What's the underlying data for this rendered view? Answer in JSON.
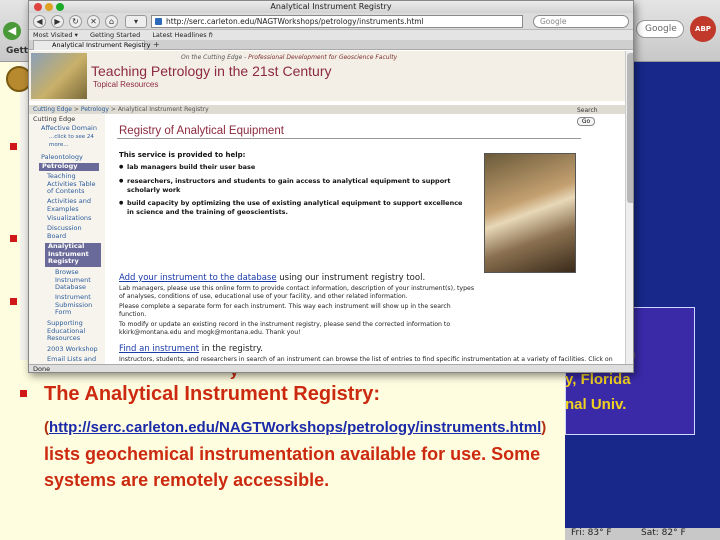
{
  "bg": {
    "getting": "Getting",
    "search_placeholder": "Google",
    "abp": "ABP",
    "weather": [
      "Fri: 83° F",
      "Sat: 82° F"
    ],
    "fragments": [
      "n",
      "y, Florida",
      "nal Univ."
    ]
  },
  "window": {
    "title": "Analytical Instrument Registry",
    "url": "http://serc.carleton.edu/NAGTWorkshops/petrology/instruments.html",
    "search_placeholder": "Google",
    "bookmarks": [
      "Most Visited ▾",
      "Getting Started",
      "Latest Headlines ℏ"
    ],
    "tab_label": "Analytical Instrument Registry",
    "status": "Done"
  },
  "banner": {
    "tagline_prefix": "On the Cutting Edge -",
    "tagline_rest": "Professional Development for Geoscience Faculty",
    "title": "Teaching Petrology in the 21st Century",
    "subtitle": "Topical Resources"
  },
  "breadcrumb": {
    "a": "Cutting Edge",
    "sep1": " > ",
    "b": "Petrology",
    "sep2": " > ",
    "c": "Analytical Instrument Registry"
  },
  "search": {
    "label": "Search",
    "go": "Go"
  },
  "sidebar": {
    "items": [
      "Cutting Edge",
      "Affective Domain",
      "...click to see 24 more...",
      "Paleontology",
      "Petrology",
      "Teaching Activities Table of Contents",
      "Activities and Examples",
      "Visualizations",
      "Discussion Board",
      "Analytical Instrument Registry",
      "Browse Instrument Database",
      "Instrument Submission Form",
      "Supporting Educational Resources",
      "2003 Workshop",
      "Email Lists and"
    ]
  },
  "main": {
    "title": "Registry of Analytical Equipment",
    "service_intro": "This service is provided to help:",
    "bullets": [
      "lab managers build their user base",
      "researchers, instructors and students to gain access to analytical equipment to support scholarly work",
      "build capacity by optimizing the use of existing analytical equipment to support excellence in science and the training of geoscientists."
    ],
    "add_link": "Add your instrument to the database",
    "add_rest": " using our instrument registry tool.",
    "add_p1": "Lab managers, please use this online form to provide contact information, description of your instrument(s), types of analyses, conditions of use, educational use of your facility, and other related information.",
    "add_p2": "Please complete a separate form for each instrument. This way each instrument will show up in the search function.",
    "add_p3": "To modify or update an existing record in the instrument registry, please send the corrected information to kkirk@montana.edu and mogk@montana.edu. Thank you!",
    "find_link": "Find an instrument",
    "find_rest": " in the registry.",
    "find_p": "Instructors, students, and researchers in search of an instrument can browse the list of entries to find specific instrumentation at a variety of facilities. Click on each record to see a complete description of the registered instruments and facilities."
  },
  "slide": {
    "heading": "The Analytical Instrument Registry:",
    "url_open": "(",
    "url": "http://serc.carleton.edu/NAGTWorkshops/petrology/instruments.html",
    "url_close": ")",
    "desc": "lists geochemical instrumentation available for use. Some systems are remotely accessible.",
    "partial": "y"
  },
  "colors": {
    "slide_red": "#cc2a10",
    "slide_blue": "#17288a",
    "banner_maroon": "#8c2a3e",
    "link_blue": "#1a3aa8"
  }
}
